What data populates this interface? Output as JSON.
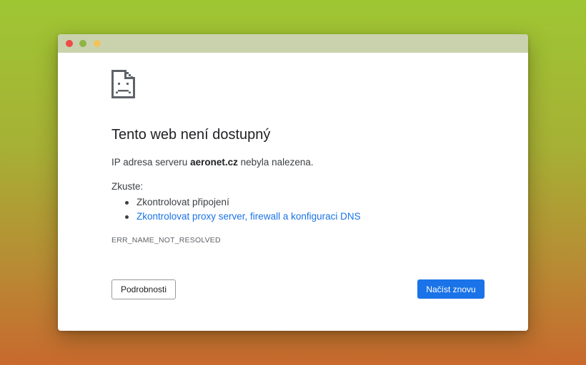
{
  "window": {
    "titlebar_color": "#c9d2ad"
  },
  "error_page": {
    "icon": "sad-page-icon",
    "headline": "Tento web není dostupný",
    "description": {
      "prefix": "IP adresa serveru ",
      "domain": "aeronet.cz",
      "suffix": " nebyla nalezena."
    },
    "try_label": "Zkuste:",
    "suggestions": [
      {
        "text": "Zkontrolovat připojení",
        "is_link": false
      },
      {
        "text": "Zkontrolovat proxy server, firewall a konfiguraci DNS",
        "is_link": true
      }
    ],
    "error_code": "ERR_NAME_NOT_RESOLVED",
    "details_button": "Podrobnosti",
    "reload_button": "Načíst znovu"
  },
  "colors": {
    "accent": "#1a73e8",
    "traffic_close": "#ee4a46",
    "traffic_min": "#8fb445",
    "traffic_max": "#f2c25c"
  }
}
